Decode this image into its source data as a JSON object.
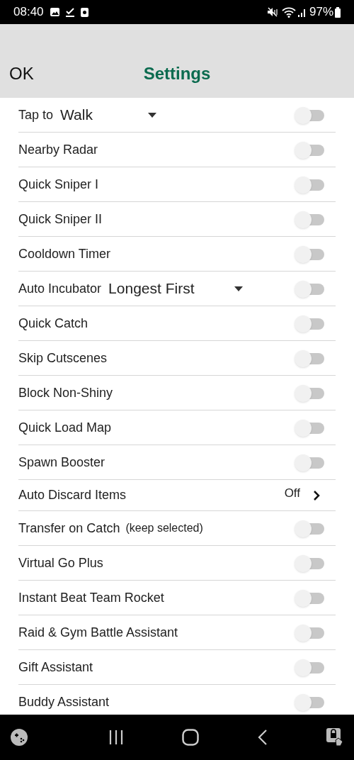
{
  "status_bar": {
    "time": "08:40",
    "battery": "97%"
  },
  "header": {
    "ok": "OK",
    "title": "Settings"
  },
  "rows": [
    {
      "kind": "dropdown",
      "label": "Tap to",
      "value": "Walk",
      "on": false
    },
    {
      "kind": "toggle",
      "label": "Nearby Radar",
      "on": false
    },
    {
      "kind": "toggle",
      "label": "Quick Sniper I",
      "on": false
    },
    {
      "kind": "toggle",
      "label": "Quick Sniper II",
      "on": false
    },
    {
      "kind": "toggle",
      "label": "Cooldown Timer",
      "on": false
    },
    {
      "kind": "dropdown",
      "label": "Auto Incubator",
      "value": "Longest First",
      "on": false
    },
    {
      "kind": "toggle",
      "label": "Quick Catch",
      "on": false
    },
    {
      "kind": "toggle",
      "label": "Skip Cutscenes",
      "on": false
    },
    {
      "kind": "toggle",
      "label": "Block Non-Shiny",
      "on": false
    },
    {
      "kind": "toggle",
      "label": "Quick Load Map",
      "on": false
    },
    {
      "kind": "toggle",
      "label": "Spawn Booster",
      "on": false
    },
    {
      "kind": "link",
      "label": "Auto Discard Items",
      "value": "Off"
    },
    {
      "kind": "toggle",
      "label": "Transfer on Catch",
      "note": "(keep selected)",
      "on": false
    },
    {
      "kind": "toggle",
      "label": "Virtual Go Plus",
      "on": false
    },
    {
      "kind": "toggle",
      "label": "Instant Beat Team Rocket",
      "on": false
    },
    {
      "kind": "toggle",
      "label": "Raid & Gym Battle Assistant",
      "on": false
    },
    {
      "kind": "toggle",
      "label": "Gift Assistant",
      "on": false
    },
    {
      "kind": "toggle",
      "label": "Buddy Assistant",
      "on": false
    }
  ]
}
